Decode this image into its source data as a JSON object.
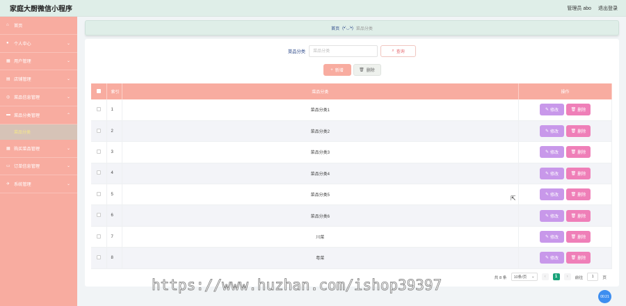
{
  "header": {
    "app_title": "家庭大厨微信小程序",
    "role_user": "管理员 abo",
    "logout": "退出登录"
  },
  "sidebar": {
    "items": [
      {
        "label": "首页",
        "icon": "home-icon",
        "expandable": false
      },
      {
        "label": "个人中心",
        "icon": "user-icon",
        "expandable": true
      },
      {
        "label": "用户管理",
        "icon": "users-icon",
        "expandable": true
      },
      {
        "label": "店铺管理",
        "icon": "shop-icon",
        "expandable": true
      },
      {
        "label": "菜品信息管理",
        "icon": "dish-icon",
        "expandable": true
      },
      {
        "label": "菜品分类管理",
        "icon": "category-icon",
        "expandable": true,
        "expanded": true
      }
    ],
    "sub_active": "菜品分类",
    "items_after": [
      {
        "label": "购买菜品管理",
        "icon": "cart-icon",
        "expandable": true
      },
      {
        "label": "订单信息管理",
        "icon": "order-icon",
        "expandable": true
      },
      {
        "label": "系统管理",
        "icon": "settings-icon",
        "expandable": true
      }
    ]
  },
  "breadcrumb": {
    "home": "首页",
    "emote": "(•'◡'•)",
    "current": "菜品分类"
  },
  "search": {
    "label": "菜品分类",
    "placeholder": "菜品分类",
    "query_button": "查询"
  },
  "actions": {
    "add": "新增",
    "delete": "删除"
  },
  "table": {
    "headers": {
      "index": "索引",
      "name": "菜品分类",
      "op": "操作"
    },
    "edit_label": "修改",
    "delete_label": "删除",
    "rows": [
      {
        "index": "1",
        "name": "菜品分类1"
      },
      {
        "index": "2",
        "name": "菜品分类2"
      },
      {
        "index": "3",
        "name": "菜品分类3"
      },
      {
        "index": "4",
        "name": "菜品分类4"
      },
      {
        "index": "5",
        "name": "菜品分类5"
      },
      {
        "index": "6",
        "name": "菜品分类6"
      },
      {
        "index": "7",
        "name": "川菜"
      },
      {
        "index": "8",
        "name": "粤菜"
      }
    ]
  },
  "pagination": {
    "total": "共 8 条",
    "page_size": "10条/页",
    "current_page": "1",
    "goto_label": "前往",
    "goto_value": "1",
    "page_unit": "页"
  },
  "watermark": "https://www.huzhan.com/ishop39397",
  "float_badge": "00:21",
  "colors": {
    "header_bg": "#dfeee8",
    "sidebar_bg": "#f8aca0",
    "accent_pink": "#f8aca0",
    "edit_purple": "#c898ea",
    "delete_pink": "#ef7fb8",
    "pager_active": "#1aa37a"
  }
}
